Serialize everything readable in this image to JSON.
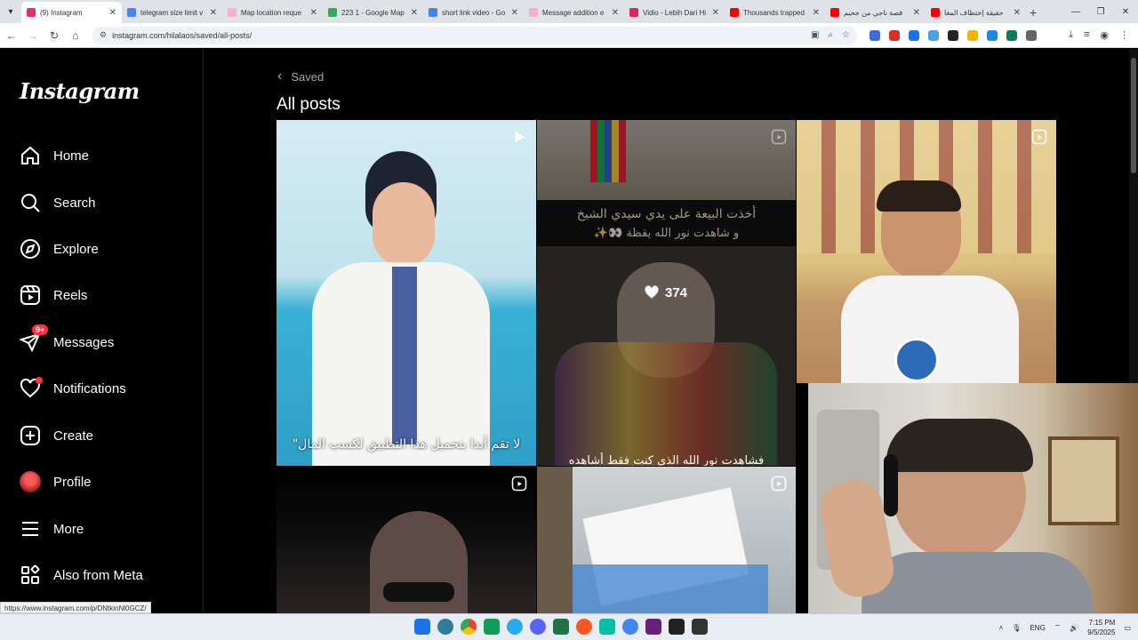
{
  "browser": {
    "tabs": [
      {
        "title": "(9) Instagram",
        "color": "#e1306c",
        "active": true
      },
      {
        "title": "telegram size limit v",
        "color": "#4285f4"
      },
      {
        "title": "Map location reque",
        "color": "#f3b0d0"
      },
      {
        "title": "223 1 - Google Map",
        "color": "#34a853"
      },
      {
        "title": "short link video - Go",
        "color": "#4285f4"
      },
      {
        "title": "Message addition e",
        "color": "#f3b0d0"
      },
      {
        "title": "Vidio - Lebih Dari Hi",
        "color": "#e0245e"
      },
      {
        "title": "Thousands trapped",
        "color": "#ff0000"
      },
      {
        "title": "قصة ناجي من جحيم",
        "color": "#ff0000"
      },
      {
        "title": "حقيقة إختطاف المغا",
        "color": "#ff0000"
      }
    ],
    "url": "instagram.com/hilalaos/saved/all-posts/",
    "status_url": "https://www.instagram.com/p/DNtkinNl0GCZ/"
  },
  "sidebar": {
    "logo": "Instagram",
    "items": [
      {
        "label": "Home",
        "icon": "home-icon"
      },
      {
        "label": "Search",
        "icon": "search-icon"
      },
      {
        "label": "Explore",
        "icon": "compass-icon"
      },
      {
        "label": "Reels",
        "icon": "reels-icon"
      },
      {
        "label": "Messages",
        "icon": "messages-icon",
        "badge": "9+"
      },
      {
        "label": "Notifications",
        "icon": "heart-icon"
      },
      {
        "label": "Create",
        "icon": "plus-square-icon"
      },
      {
        "label": "Profile",
        "icon": "avatar"
      },
      {
        "label": "More",
        "icon": "menu-icon"
      },
      {
        "label": "Also from Meta",
        "icon": "meta-grid-icon"
      }
    ]
  },
  "main": {
    "back_label": "Saved",
    "title": "All posts",
    "posts": [
      {
        "caption": "لا تقم أبدا بتحميل هذا التطبيق لكسب المال\""
      },
      {
        "caption_top": "أخذت البيعة على يدي سيدي الشيخ",
        "caption_top2": "و شاهدت نور الله يقظة 👀✨",
        "likes": "374",
        "caption_bottom": "فشاهدت نور الله الذي كنت فقط أشاهده"
      },
      {},
      {},
      {}
    ]
  },
  "taskbar": {
    "lang": "ENG",
    "time": "7:15 PM",
    "date": "9/5/2025"
  }
}
